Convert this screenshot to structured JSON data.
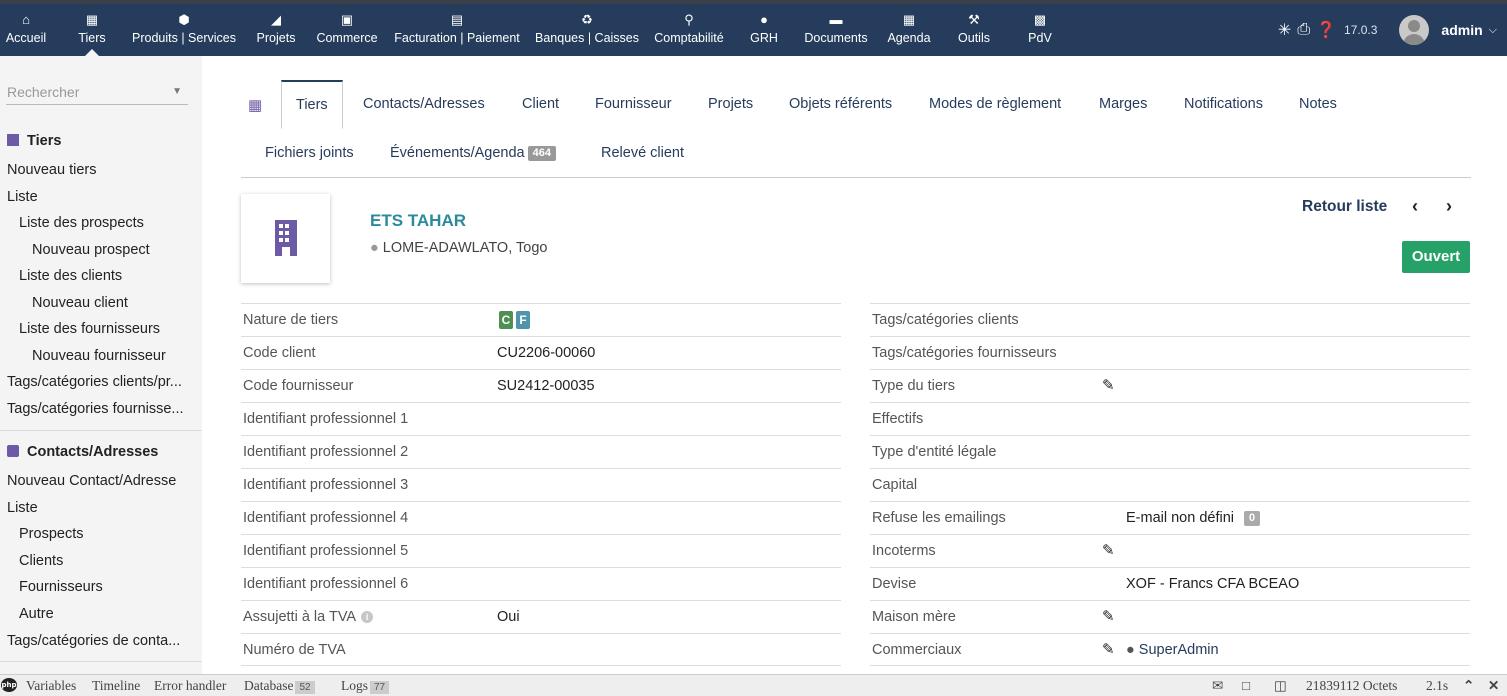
{
  "topbar": {
    "menu": [
      {
        "label": "Accueil",
        "icon": "home-icon"
      },
      {
        "label": "Tiers",
        "icon": "building-icon"
      },
      {
        "label": "Produits | Services",
        "icon": "cube-icon"
      },
      {
        "label": "Projets",
        "icon": "sitemap-icon"
      },
      {
        "label": "Commerce",
        "icon": "suitcase-icon"
      },
      {
        "label": "Facturation | Paiement",
        "icon": "invoice-icon"
      },
      {
        "label": "Banques | Caisses",
        "icon": "bank-icon"
      },
      {
        "label": "Comptabilité",
        "icon": "search-dollar-icon"
      },
      {
        "label": "GRH",
        "icon": "user-tie-icon"
      },
      {
        "label": "Documents",
        "icon": "folder-open-icon"
      },
      {
        "label": "Agenda",
        "icon": "calendar-icon"
      },
      {
        "label": "Outils",
        "icon": "wrench-icon"
      },
      {
        "label": "PdV",
        "icon": "cash-register-icon"
      }
    ],
    "version": "17.0.3",
    "user": "admin",
    "bg_color": "#263c5c"
  },
  "sidebar": {
    "search_placeholder": "Rechercher",
    "tiers_title": "Tiers",
    "tiers_links": [
      "Nouveau tiers",
      "Liste",
      "Liste des prospects",
      "Nouveau prospect",
      "Liste des clients",
      "Nouveau client",
      "Liste des fournisseurs",
      "Nouveau fournisseur",
      "Tags/catégories clients/pr...",
      "Tags/catégories fournisse..."
    ],
    "contacts_title": "Contacts/Adresses",
    "contacts_links": [
      "Nouveau Contact/Adresse",
      "Liste",
      "Prospects",
      "Clients",
      "Fournisseurs",
      "Autre",
      "Tags/catégories de conta..."
    ]
  },
  "tabs": [
    "Tiers",
    "Contacts/Adresses",
    "Client",
    "Fournisseur",
    "Projets",
    "Objets référents",
    "Modes de règlement",
    "Marges",
    "Notifications",
    "Notes",
    "Fichiers joints",
    "Événements/Agenda",
    "Relevé client"
  ],
  "events_count": "464",
  "thirdparty": {
    "name": "ETS TAHAR",
    "address": "LOME-ADAWLATO, Togo",
    "back_label": "Retour liste",
    "status": "Ouvert"
  },
  "left_fields": [
    {
      "label": "Nature de tiers",
      "value": ""
    },
    {
      "label": "Code client",
      "value": "CU2206-00060"
    },
    {
      "label": "Code fournisseur",
      "value": "SU2412-00035"
    },
    {
      "label": "Identifiant professionnel 1",
      "value": ""
    },
    {
      "label": "Identifiant professionnel 2",
      "value": ""
    },
    {
      "label": "Identifiant professionnel 3",
      "value": ""
    },
    {
      "label": "Identifiant professionnel 4",
      "value": ""
    },
    {
      "label": "Identifiant professionnel 5",
      "value": ""
    },
    {
      "label": "Identifiant professionnel 6",
      "value": ""
    },
    {
      "label": "Assujetti à la TVA",
      "value": "Oui"
    },
    {
      "label": "Numéro de TVA",
      "value": ""
    }
  ],
  "nature_badges": [
    "C",
    "F"
  ],
  "right_fields": [
    {
      "label": "Tags/catégories clients",
      "value": ""
    },
    {
      "label": "Tags/catégories fournisseurs",
      "value": ""
    },
    {
      "label": "Type du tiers",
      "value": ""
    },
    {
      "label": "Effectifs",
      "value": ""
    },
    {
      "label": "Type d'entité légale",
      "value": ""
    },
    {
      "label": "Capital",
      "value": ""
    },
    {
      "label": "Refuse les emailings",
      "value": "E-mail non défini"
    },
    {
      "label": "Incoterms",
      "value": ""
    },
    {
      "label": "Devise",
      "value": "XOF - Francs CFA BCEAO"
    },
    {
      "label": "Maison mère",
      "value": ""
    },
    {
      "label": "Commerciaux",
      "value": "SuperAdmin"
    }
  ],
  "emailings_count": "0",
  "debugbar": {
    "items": [
      "Variables",
      "Timeline",
      "Error handler",
      "Database",
      "Logs"
    ],
    "database_count": "52",
    "logs_count": "77",
    "memory": "21839112 Octets",
    "time": "2.1s"
  }
}
